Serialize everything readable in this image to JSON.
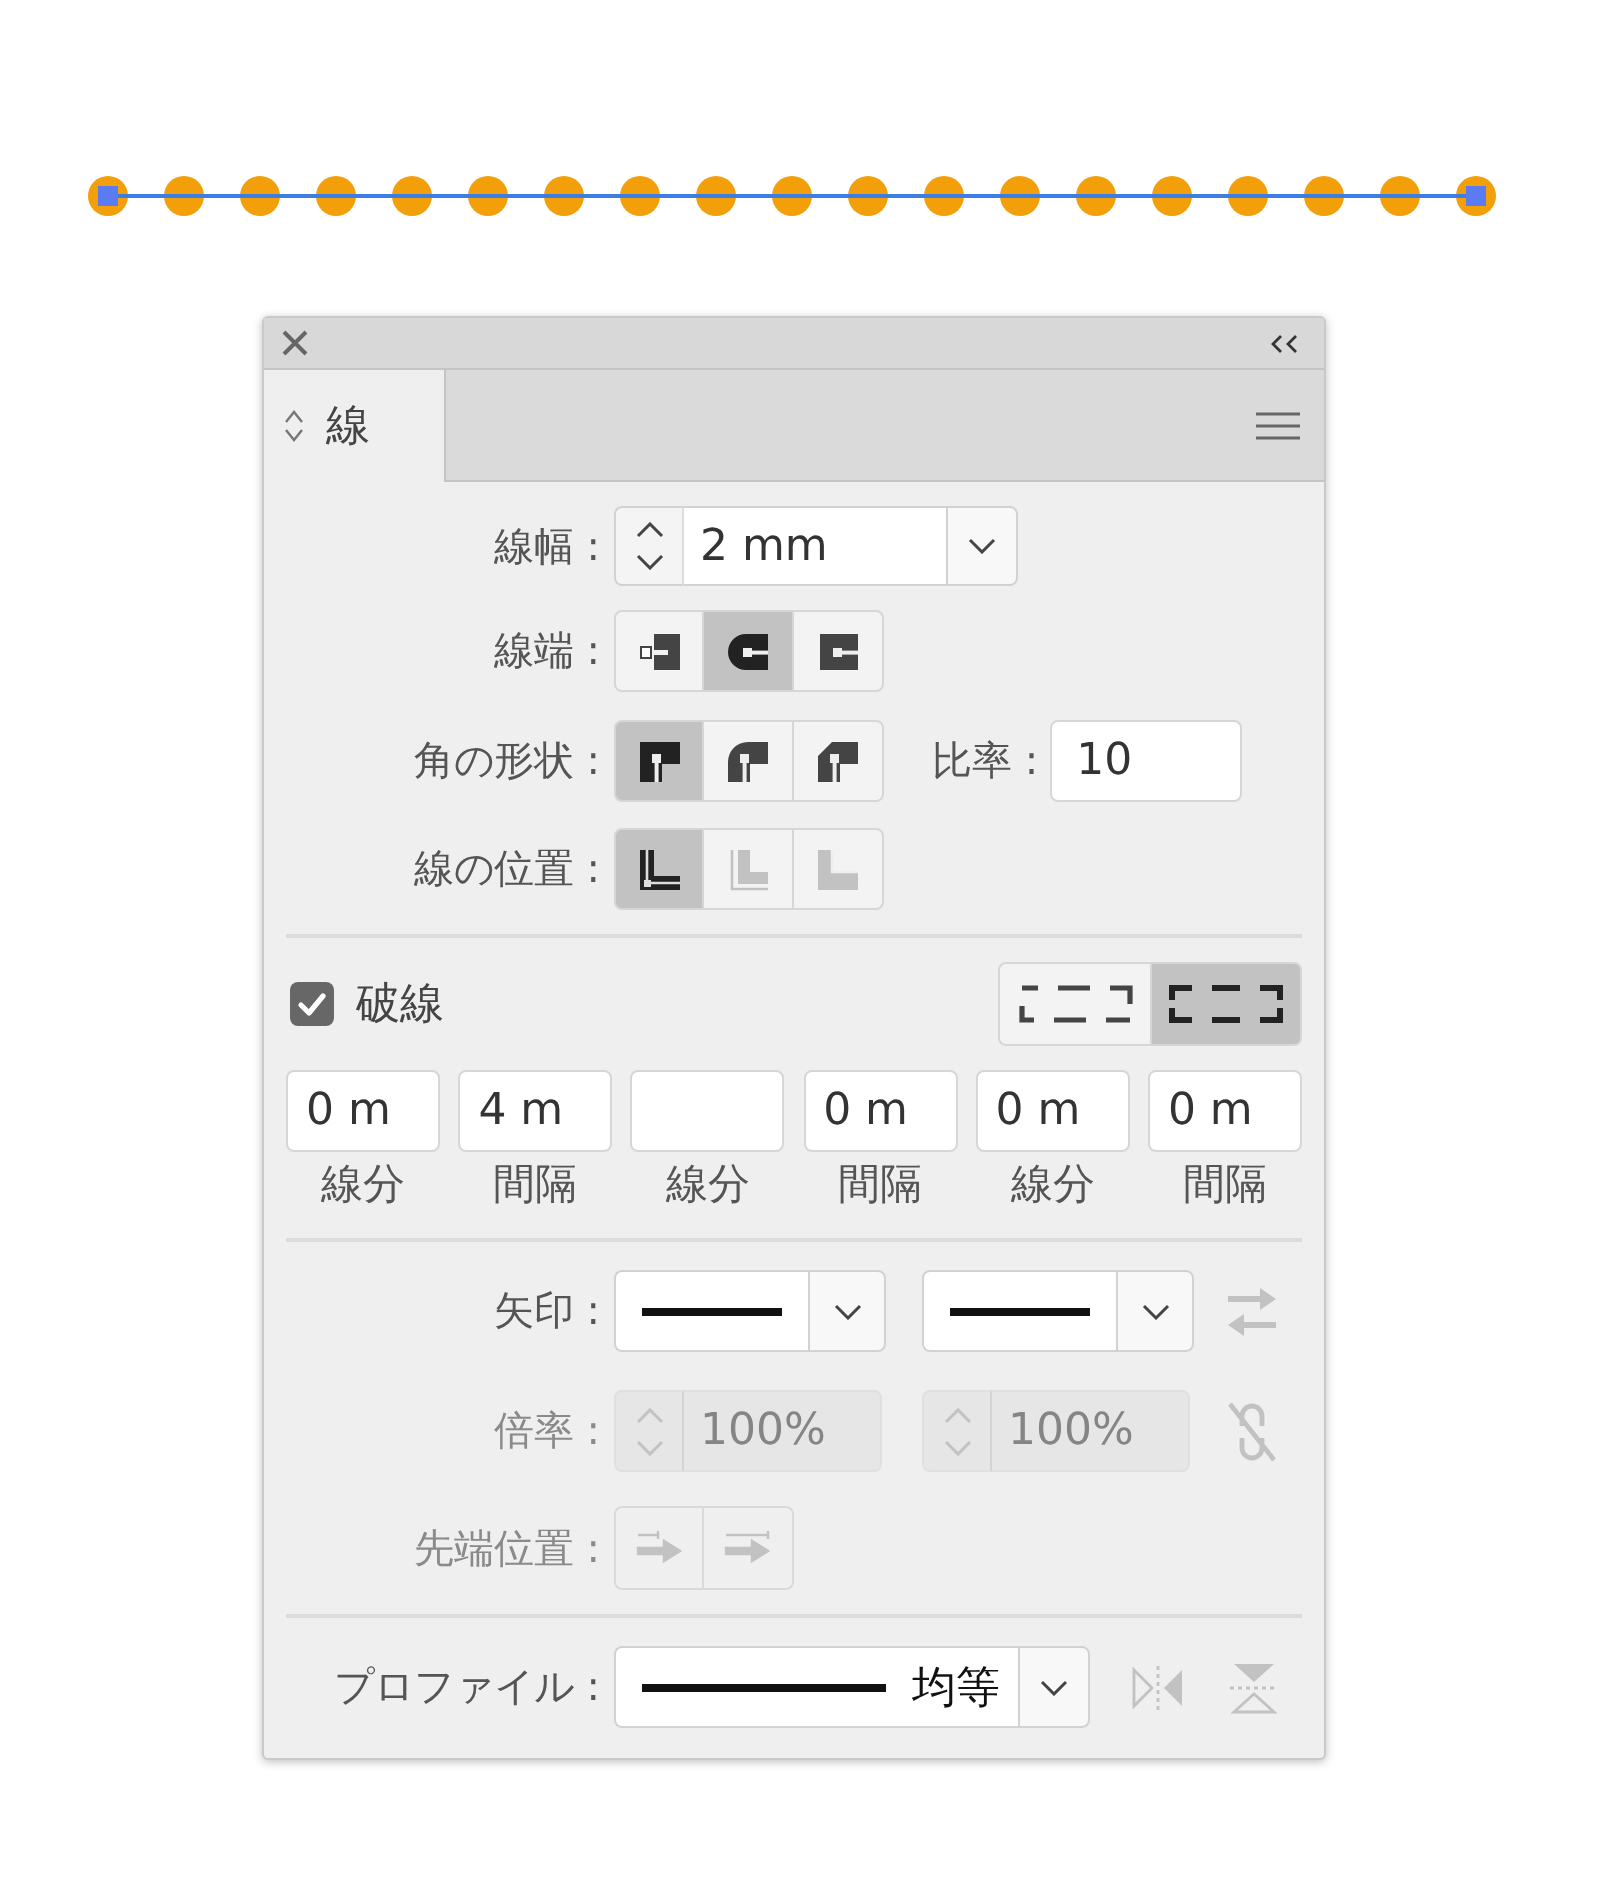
{
  "tab": {
    "label": "線",
    "selected": true
  },
  "stroke_weight": {
    "label": "線幅 :",
    "value": "2 mm"
  },
  "cap": {
    "label": "線端 :",
    "options": [
      {
        "kind": "butt",
        "selected": false
      },
      {
        "kind": "round",
        "selected": true
      },
      {
        "kind": "projecting",
        "selected": false
      }
    ]
  },
  "corner": {
    "label": "角の形状 :",
    "options": [
      {
        "kind": "miter",
        "selected": true
      },
      {
        "kind": "round",
        "selected": false
      },
      {
        "kind": "bevel",
        "selected": false
      }
    ],
    "limit_label": "比率 :",
    "limit_value": "10"
  },
  "align_stroke": {
    "label": "線の位置 :",
    "options": [
      {
        "kind": "center",
        "selected": true,
        "disabled": false
      },
      {
        "kind": "inside",
        "selected": false,
        "disabled": true
      },
      {
        "kind": "outside",
        "selected": false,
        "disabled": true
      }
    ]
  },
  "dashed_line": {
    "label": "破線",
    "checked": true,
    "modes": [
      {
        "kind": "exact",
        "selected": false
      },
      {
        "kind": "aligned",
        "selected": true
      }
    ],
    "fields": [
      {
        "value": "0 m",
        "label": "線分"
      },
      {
        "value": "4 m",
        "label": "間隔"
      },
      {
        "label": "線分"
      },
      {
        "value": "0 m",
        "label": "間隔"
      },
      {
        "value": "0 m",
        "label": "線分"
      },
      {
        "value": "0 m",
        "label": "間隔"
      }
    ]
  },
  "arrowheads": {
    "label": "矢印 :",
    "swap_disabled": true
  },
  "scale": {
    "label": "倍率 :",
    "disabled": true,
    "start": "100%",
    "end": "100%"
  },
  "align_arrow": {
    "label": "先端位置 :",
    "disabled": true,
    "options": [
      {
        "kind": "extend",
        "selected": false
      },
      {
        "kind": "place",
        "selected": false
      }
    ]
  },
  "profile": {
    "label": "プロファイル :",
    "value": "均等",
    "flip_disabled": true
  }
}
